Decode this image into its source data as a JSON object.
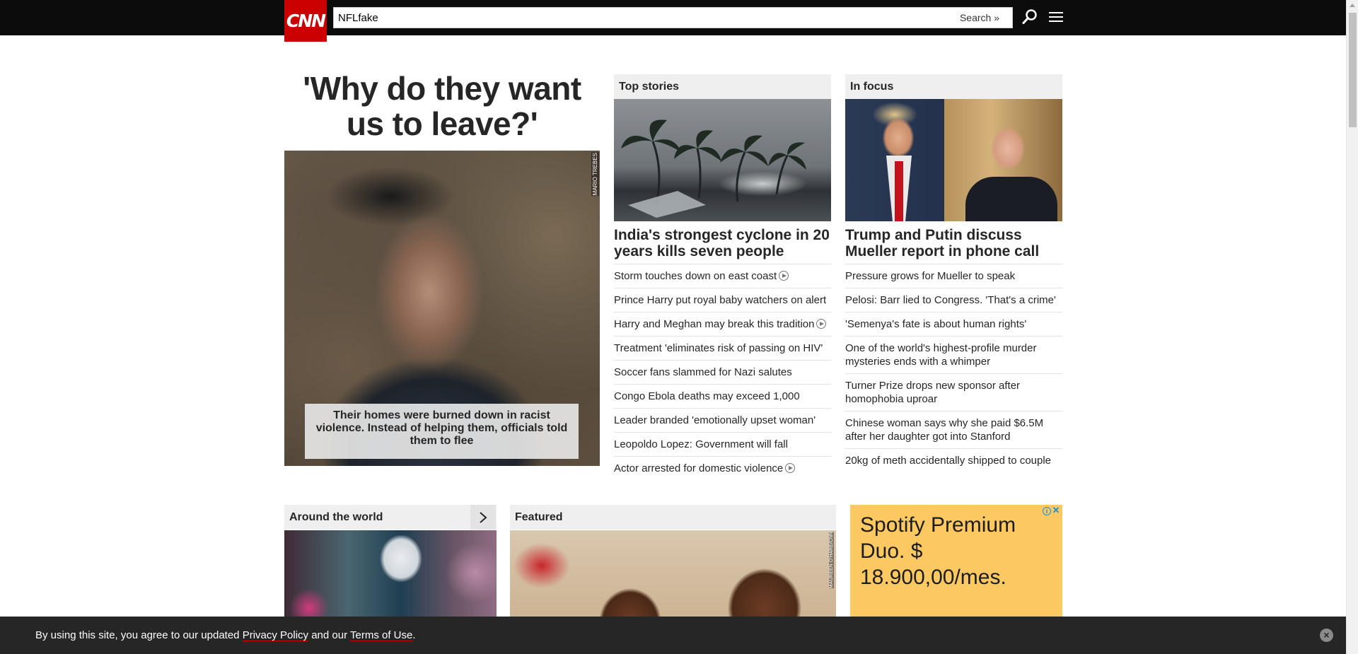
{
  "header": {
    "logo_text": "CNN",
    "search_value": "NFLfake",
    "search_button": "Search »",
    "accent_color": "#cc0000"
  },
  "hero": {
    "headline": "'Why do they want us to leave?'",
    "caption": "Their homes were burned down in racist violence. Instead of helping them, officials told them to flee",
    "credit": "MARIO TREBES"
  },
  "top_stories": {
    "header": "Top stories",
    "lead_headline": "India's strongest cyclone in 20 years kills seven people",
    "links": [
      {
        "text": "Storm touches down on east coast",
        "video": true
      },
      {
        "text": "Prince Harry put royal baby watchers on alert",
        "video": false
      },
      {
        "text": "Harry and Meghan may break this tradition",
        "video": true
      },
      {
        "text": "Treatment 'eliminates risk of passing on HIV'",
        "video": false
      },
      {
        "text": "Soccer fans slammed for Nazi salutes",
        "video": false
      },
      {
        "text": "Congo Ebola deaths may exceed 1,000",
        "video": false
      },
      {
        "text": "Leader branded 'emotionally upset woman'",
        "video": false
      },
      {
        "text": "Leopoldo Lopez: Government will fall",
        "video": false
      },
      {
        "text": "Actor arrested for domestic violence",
        "video": true
      }
    ]
  },
  "in_focus": {
    "header": "In focus",
    "lead_headline": "Trump and Putin discuss Mueller report in phone call",
    "links": [
      {
        "text": "Pressure grows for Mueller to speak"
      },
      {
        "text": "Pelosi: Barr lied to Congress. 'That's a crime'"
      },
      {
        "text": "'Semenya's fate is about human rights'"
      },
      {
        "text": "One of the world's highest-profile murder mysteries ends with a whimper"
      },
      {
        "text": "Turner Prize drops new sponsor after homophobia uproar"
      },
      {
        "text": "Chinese woman says why she paid $6.5M after her daughter got into Stanford"
      },
      {
        "text": "20kg of meth accidentally shipped to couple"
      }
    ]
  },
  "around_world": {
    "header": "Around the world"
  },
  "featured": {
    "header": "Featured",
    "credit": "MAUREEN O'HARE/CNN"
  },
  "ad": {
    "text": "Spotify Premium Duo. $ 18.900,00/mes.",
    "info": "i",
    "close": "✕",
    "background": "#fbc862"
  },
  "cookie": {
    "prefix": "By using this site, you agree to our updated ",
    "privacy_link": "Privacy Policy",
    "middle": " and our ",
    "terms_link": "Terms of Use",
    "suffix": ".",
    "close": "×"
  }
}
